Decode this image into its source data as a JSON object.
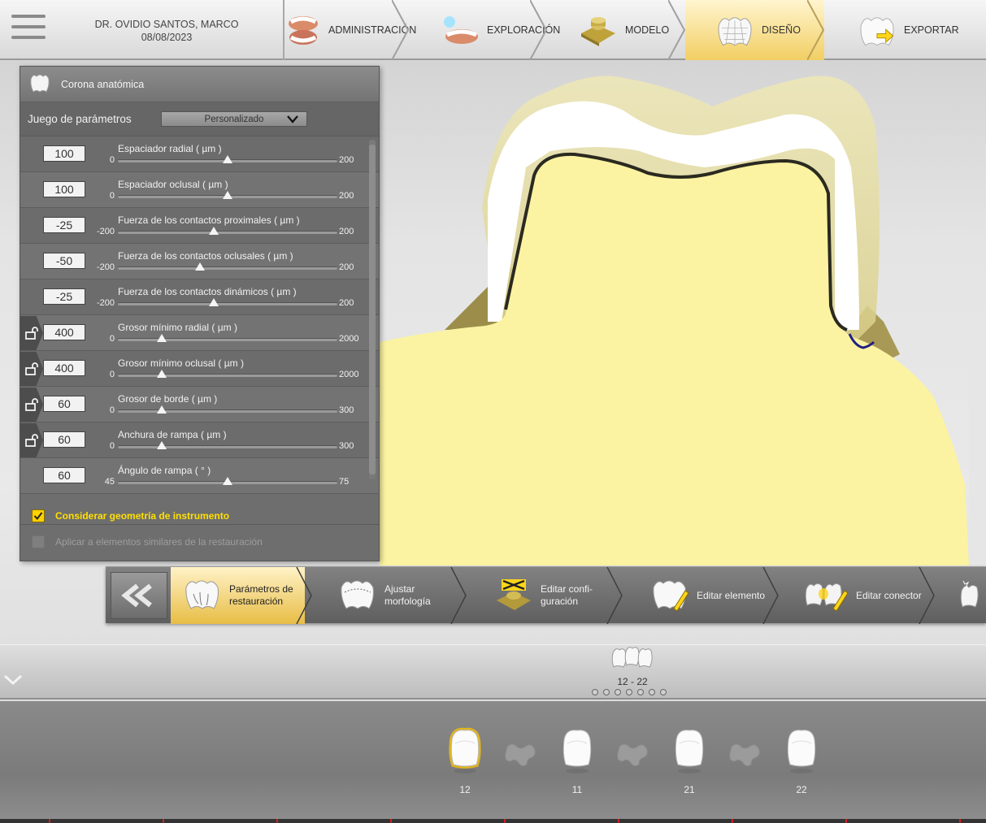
{
  "header": {
    "patient_name": "DR. OVIDIO SANTOS, MARCO",
    "date": "08/08/2023",
    "steps": [
      {
        "label": "ADMINISTRACIÓN",
        "icon": "dentures-icon",
        "active": false
      },
      {
        "label": "EXPLORACIÓN",
        "icon": "scan-jaw-icon",
        "active": false
      },
      {
        "label": "MODELO",
        "icon": "model-icon",
        "active": false
      },
      {
        "label": "DISEÑO",
        "icon": "crown-design-icon",
        "active": true
      },
      {
        "label": "EXPORTAR",
        "icon": "export-crown-icon",
        "active": false
      }
    ]
  },
  "panel": {
    "title": "Corona anatómica",
    "preset_label": "Juego de parámetros",
    "preset_value": "Personalizado",
    "params": [
      {
        "name": "Espaciador radial  ( µm )",
        "value": "100",
        "min": "0",
        "max": "200",
        "level": 0.5,
        "locked": false
      },
      {
        "name": "Espaciador oclusal  ( µm )",
        "value": "100",
        "min": "0",
        "max": "200",
        "level": 0.5,
        "locked": false
      },
      {
        "name": "Fuerza de los contactos proximales  ( µm )",
        "value": "-25",
        "min": "-200",
        "max": "200",
        "level": 0.4375,
        "locked": false
      },
      {
        "name": "Fuerza de los contactos oclusales  ( µm )",
        "value": "-50",
        "min": "-200",
        "max": "200",
        "level": 0.375,
        "locked": false
      },
      {
        "name": "Fuerza de los contactos dinámicos  ( µm )",
        "value": "-25",
        "min": "-200",
        "max": "200",
        "level": 0.4375,
        "locked": false
      },
      {
        "name": "Grosor mínimo radial  ( µm )",
        "value": "400",
        "min": "0",
        "max": "2000",
        "level": 0.2,
        "locked": true
      },
      {
        "name": "Grosor mínimo oclusal  ( µm )",
        "value": "400",
        "min": "0",
        "max": "2000",
        "level": 0.2,
        "locked": true
      },
      {
        "name": "Grosor de borde  ( µm )",
        "value": "60",
        "min": "0",
        "max": "300",
        "level": 0.2,
        "locked": true
      },
      {
        "name": "Anchura de rampa  ( µm )",
        "value": "60",
        "min": "0",
        "max": "300",
        "level": 0.2,
        "locked": true
      },
      {
        "name": "Ángulo de rampa  ( ° )",
        "value": "60",
        "min": "45",
        "max": "75",
        "level": 0.5,
        "locked": false
      }
    ],
    "consider_geometry_label": "Considerar geometría de instrumento",
    "consider_geometry_checked": true,
    "apply_similar_label": "Aplicar a elementos similares de la restauración",
    "apply_similar_checked": false
  },
  "toolbar": {
    "steps": [
      {
        "label_line1": "Parámetros de",
        "label_line2": "restauración",
        "icon": "restoration-params-icon",
        "active": true
      },
      {
        "label_line1": "Ajustar",
        "label_line2": "morfología",
        "icon": "adjust-morphology-icon",
        "active": false
      },
      {
        "label_line1": "Editar confi-",
        "label_line2": "guración",
        "icon": "edit-config-icon",
        "active": false
      },
      {
        "label_line1": "Editar elemento",
        "label_line2": "",
        "icon": "edit-element-icon",
        "active": false
      },
      {
        "label_line1": "Editar conector",
        "label_line2": "",
        "icon": "edit-connector-icon",
        "active": false
      }
    ]
  },
  "restoration": {
    "bridge_label": "12 - 22",
    "page_count": 7
  },
  "teeth": [
    {
      "number": "12",
      "selected": true
    },
    {
      "number": "11",
      "selected": false
    },
    {
      "number": "21",
      "selected": false
    },
    {
      "number": "22",
      "selected": false
    }
  ],
  "colors": {
    "accent": "#f2cf63",
    "checkbox": "#ffd200",
    "die": "#fbf3a2",
    "crown": "#ffffff"
  }
}
